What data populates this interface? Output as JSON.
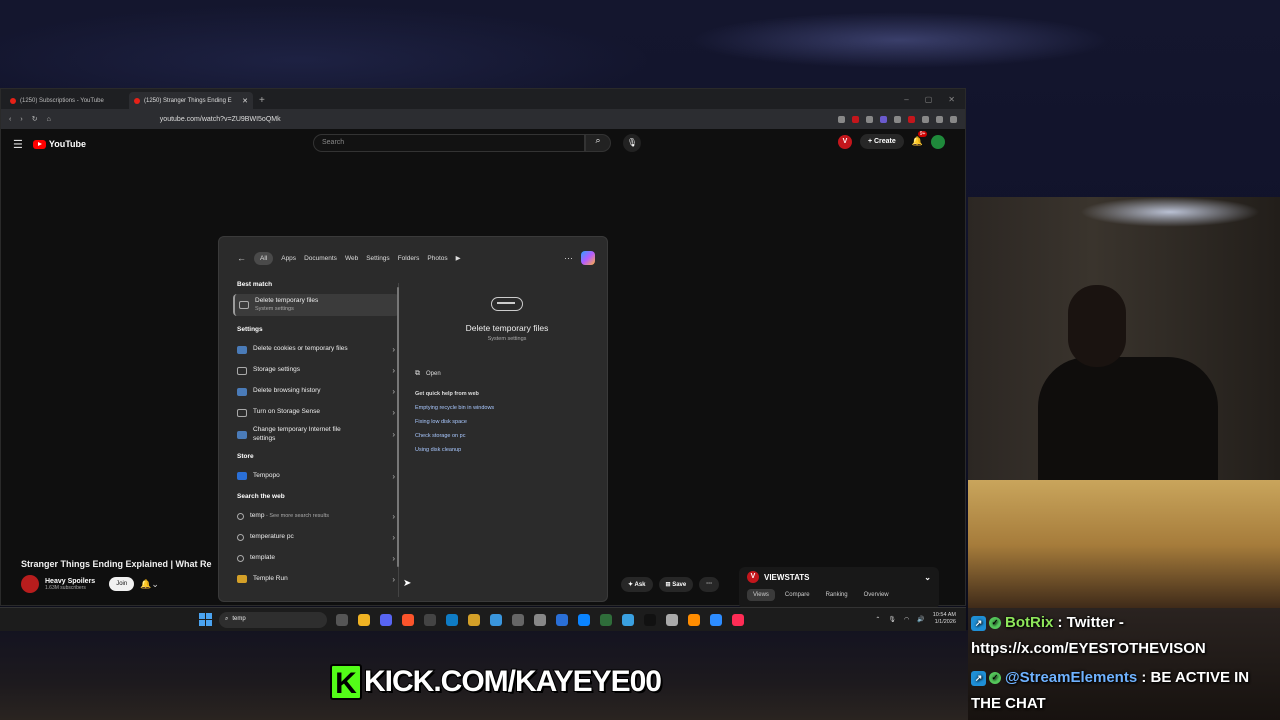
{
  "browser": {
    "tabs": [
      {
        "label": "(1250) Subscriptions - YouTube"
      },
      {
        "label": "(1250) Stranger Things Ending E"
      }
    ],
    "new_tab": "+",
    "url": "youtube.com/watch?v=ZU9BWI5oQMk"
  },
  "youtube": {
    "logo": "YouTube",
    "search_placeholder": "Search",
    "create_label": "Create",
    "notif_count": "9+",
    "video_title": "Stranger Things Ending Explained | What Re",
    "channel_name": "Heavy Spoilers",
    "channel_subs": "1.63M subscribers",
    "join_label": "Join",
    "ask_label": "Ask",
    "save_label": "Save",
    "more_label": "···"
  },
  "viewstats": {
    "title": "VIEWSTATS",
    "tabs": [
      "Views",
      "Compare",
      "Ranking",
      "Overview"
    ]
  },
  "search_panel": {
    "filters": [
      "All",
      "Apps",
      "Documents",
      "Web",
      "Settings",
      "Folders",
      "Photos"
    ],
    "best_match_header": "Best match",
    "best_match": {
      "title": "Delete temporary files",
      "subtitle": "System settings"
    },
    "settings_header": "Settings",
    "settings_items": [
      "Delete cookies or temporary files",
      "Storage settings",
      "Delete browsing history",
      "Turn on Storage Sense",
      "Change temporary Internet file settings"
    ],
    "store_header": "Store",
    "store_items": [
      "Tempopo"
    ],
    "web_header": "Search the web",
    "web_items": [
      {
        "label": "temp",
        "suffix": " - See more search results"
      },
      {
        "label": "temperature pc",
        "suffix": ""
      },
      {
        "label": "template",
        "suffix": ""
      },
      {
        "label": "Temple Run",
        "suffix": ""
      }
    ],
    "preview": {
      "title": "Delete temporary files",
      "subtitle": "System settings",
      "open_label": "Open",
      "quick_help": "Get quick help from web",
      "links": [
        "Emptying recycle bin in windows",
        "Fixing low disk space",
        "Check storage on pc",
        "Using disk cleanup"
      ]
    }
  },
  "taskbar": {
    "search_value": "temp",
    "time": "10:54 AM",
    "date": "1/1/2026"
  },
  "chat": [
    {
      "user": "BotRix",
      "message": ": Twitter - https://x.com/EYESTOTHEVISON"
    },
    {
      "user": "@StreamElements",
      "message": ": BE ACTIVE IN THE CHAT"
    }
  ],
  "banner": {
    "k": "K",
    "text": "KICK.COM/KAYEYE00"
  },
  "colors": {
    "youtube_red": "#ff0000",
    "kick_green": "#53fc18",
    "taskbar_bg": "#1c1c1c"
  }
}
